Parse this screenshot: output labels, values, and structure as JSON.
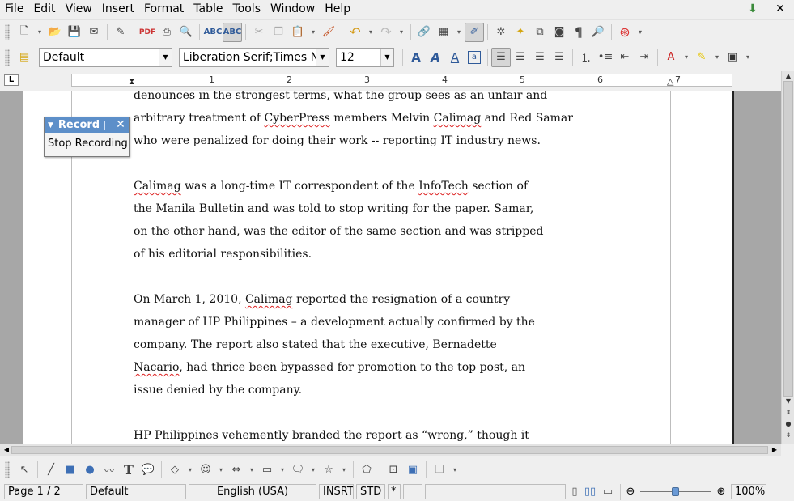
{
  "menubar": {
    "items": [
      "File",
      "Edit",
      "View",
      "Insert",
      "Format",
      "Table",
      "Tools",
      "Window",
      "Help"
    ]
  },
  "formatting": {
    "style": "Default",
    "font": "Liberation Serif;Times New Roman",
    "size": "12"
  },
  "ruler": {
    "numbers": [
      "1",
      "2",
      "3",
      "4",
      "5",
      "6",
      "7"
    ]
  },
  "record_dialog": {
    "title": "Record",
    "stop_label": "Stop Recording"
  },
  "document": {
    "lines": [
      [
        {
          "t": "denounces in the strongest terms, what the group sees as an unfair and"
        }
      ],
      [
        {
          "t": "arbitrary treatment of "
        },
        {
          "t": "CyberPress",
          "sp": true
        },
        {
          "t": " members Melvin "
        },
        {
          "t": "Calimag",
          "sp": true
        },
        {
          "t": " and Red Samar"
        }
      ],
      [
        {
          "t": "who were penalized for doing their work -- reporting IT industry news."
        }
      ],
      [],
      [
        {
          "t": "Calimag",
          "sp": true
        },
        {
          "t": " was a long-time IT correspondent of the "
        },
        {
          "t": "InfoTech",
          "sp": true
        },
        {
          "t": " section of"
        }
      ],
      [
        {
          "t": "the Manila Bulletin and was told to stop writing for the paper. Samar,"
        }
      ],
      [
        {
          "t": "on the other hand, was the editor of the same section and was stripped"
        }
      ],
      [
        {
          "t": "of his editorial responsibilities."
        }
      ],
      [],
      [
        {
          "t": "On March 1, 2010, "
        },
        {
          "t": "Calimag",
          "sp": true
        },
        {
          "t": " reported the resignation of a country"
        }
      ],
      [
        {
          "t": "manager of HP Philippines – a development actually confirmed by the"
        }
      ],
      [
        {
          "t": "company. The report also stated that the executive, Bernadette"
        }
      ],
      [
        {
          "t": "Nacario",
          "sp": true
        },
        {
          "t": ", had thrice been bypassed for promotion to the top post, an"
        }
      ],
      [
        {
          "t": "issue denied by the company."
        }
      ],
      [],
      [
        {
          "t": "HP Philippines vehemently branded the report as “wrong,” though it"
        }
      ]
    ]
  },
  "statusbar": {
    "page": "Page 1 / 2",
    "page_style": "Default",
    "language": "English (USA)",
    "insert_mode": "INSRT",
    "selection_mode": "STD",
    "modified": "*",
    "zoom_percent": 100,
    "zoom": "100%"
  },
  "icons": {
    "toolbar1": [
      "new-icon",
      "open-icon",
      "save-icon",
      "email-icon",
      "edit-file-icon",
      "pdf-icon",
      "print-icon",
      "print-preview-icon",
      "spellcheck-icon",
      "autospell-icon",
      "cut-icon",
      "copy-icon",
      "paste-icon",
      "clone-format-icon",
      "undo-icon",
      "redo-icon",
      "hyperlink-icon",
      "table-icon",
      "show-draw-icon",
      "navigator-icon",
      "gallery-icon",
      "data-sources-icon",
      "nonprinting-icon",
      "zoom-icon",
      "help-icon"
    ],
    "toolbar2": [
      "styles-icon",
      "bold-icon",
      "italic-icon",
      "underline-icon",
      "align-left-icon",
      "align-center-icon",
      "align-right-icon",
      "justify-icon",
      "numbering-icon",
      "bullets-icon",
      "decrease-indent-icon",
      "increase-indent-icon",
      "font-color-icon",
      "highlight-icon",
      "background-color-icon"
    ]
  }
}
